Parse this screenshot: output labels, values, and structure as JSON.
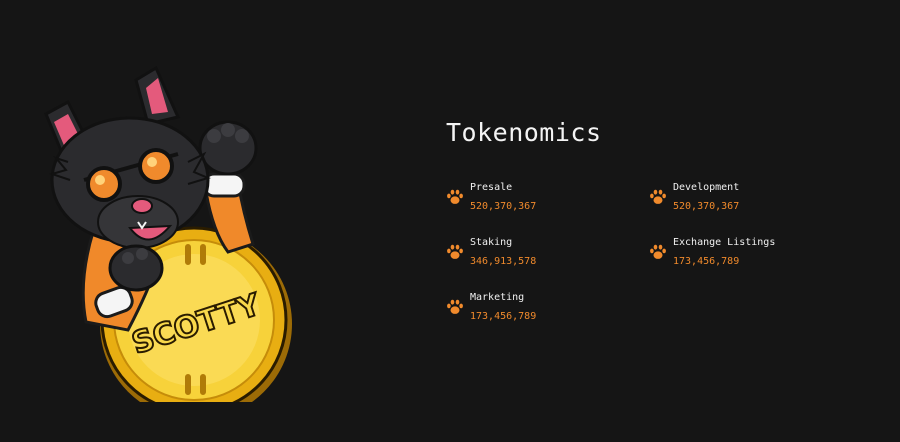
{
  "mascot": {
    "coin_text": "SCOTTY"
  },
  "section": {
    "title": "Tokenomics"
  },
  "allocations": [
    {
      "label": "Presale",
      "value": "520,370,367"
    },
    {
      "label": "Development",
      "value": "520,370,367"
    },
    {
      "label": "Staking",
      "value": "346,913,578"
    },
    {
      "label": "Exchange Listings",
      "value": "173,456,789"
    },
    {
      "label": "Marketing",
      "value": "173,456,789"
    }
  ],
  "icons": {
    "item_icon": "paw-icon"
  },
  "colors": {
    "background": "#151515",
    "accent": "#f08a2c",
    "text": "#f2f2f2",
    "coin_gold": "#f3c62a"
  }
}
